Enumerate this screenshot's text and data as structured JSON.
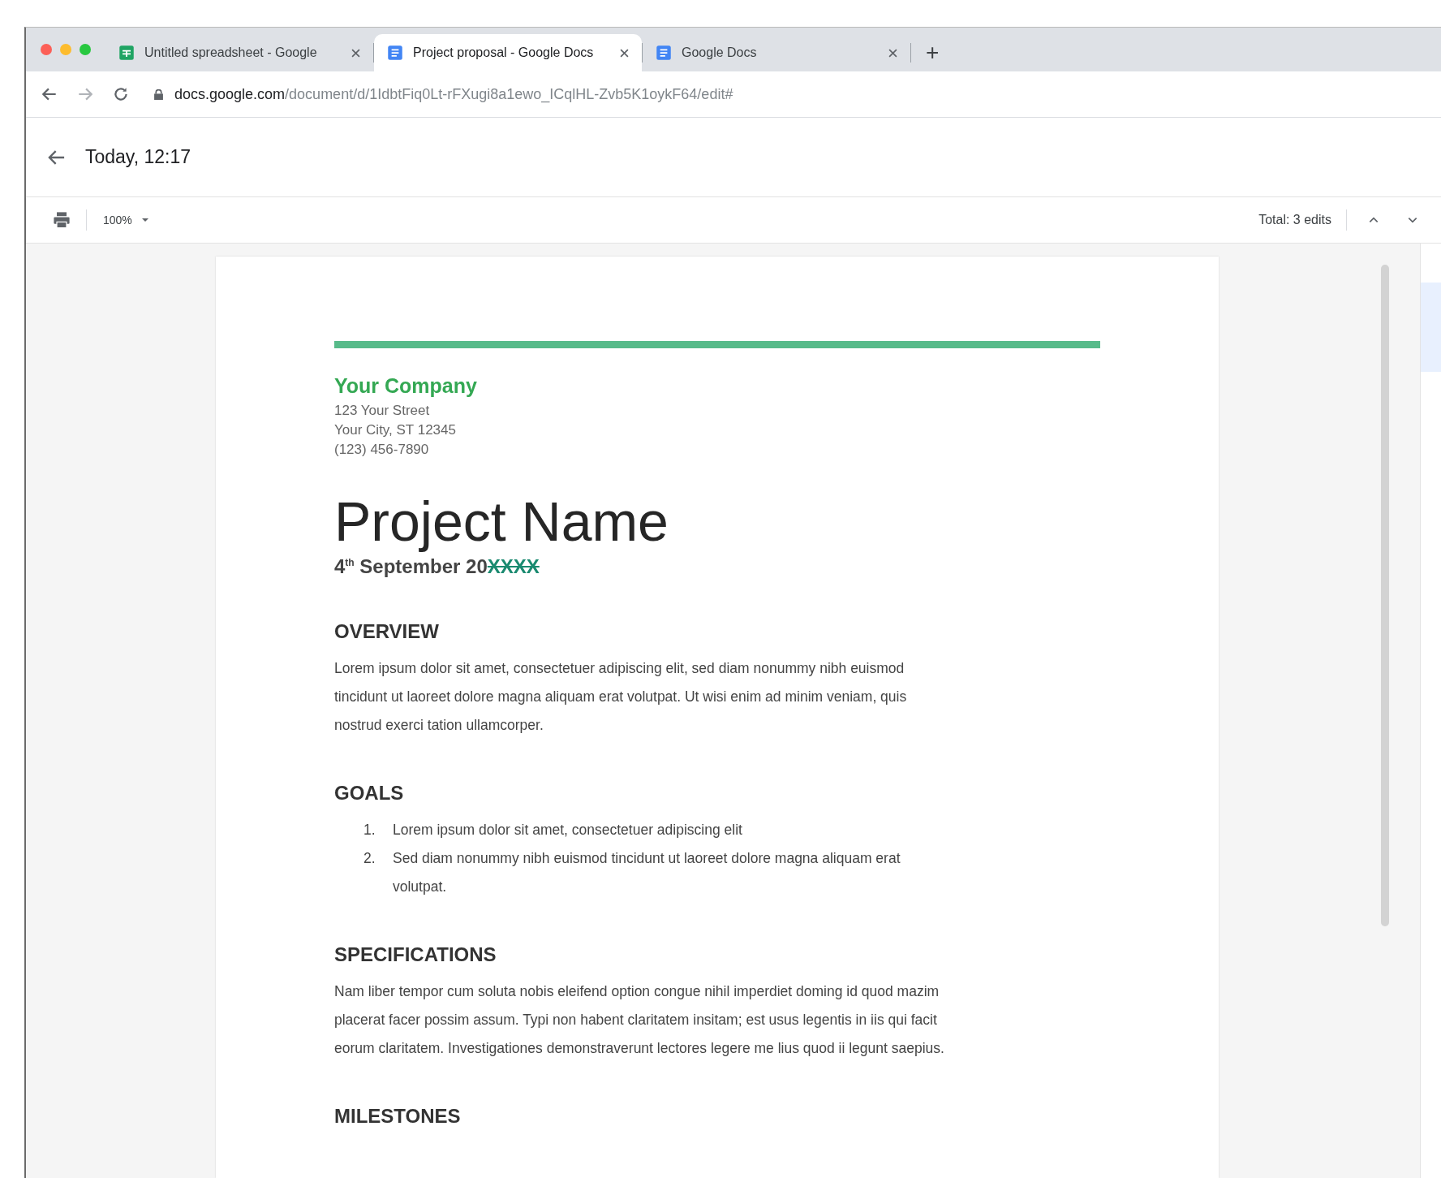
{
  "tabs": [
    {
      "title": "Untitled spreadsheet - Google",
      "kind": "sheets",
      "selected": false
    },
    {
      "title": "Project proposal - Google Docs",
      "kind": "docs",
      "selected": true
    },
    {
      "title": "Google Docs",
      "kind": "docs",
      "selected": false
    }
  ],
  "new_tab": "+",
  "address_bar": {
    "host": "docs.google.com",
    "path": "/document/d/1IdbtFiq0Lt-rFXugi8a1ewo_ICqlHL-Zvb5K1oykF64/edit#"
  },
  "header": {
    "title": "Today, 12:17"
  },
  "toolbar": {
    "zoom": "100%",
    "edits": "Total: 3 edits"
  },
  "document": {
    "company": "Your Company",
    "address_lines": [
      "123 Your Street",
      "Your City, ST 12345",
      "(123) 456-7890"
    ],
    "title": "Project Name",
    "date": {
      "text": "4$^{th}$ September 20",
      "suggestion": "XXXX"
    },
    "sections": [
      {
        "heading": "OVERVIEW",
        "kind": "paragraph",
        "text": "Lorem ipsum dolor sit amet, consectetuer adipiscing elit, sed diam nonummy nibh euismod\ntincidunt ut laoreet dolore magna aliquam erat volutpat. Ut wisi enim ad minim veniam, quis\nnostrud exerci tation ullamcorper."
      },
      {
        "heading": "GOALS",
        "kind": "list",
        "items": [
          {
            "number": "1.",
            "text": "Lorem ipsum dolor sit amet, consectetuer adipiscing elit"
          },
          {
            "number": "2.",
            "text": "Sed diam nonummy nibh euismod tincidunt ut laoreet dolore magna aliquam erat\nvolutpat."
          }
        ]
      },
      {
        "heading": "SPECIFICATIONS",
        "kind": "paragraph",
        "text": "Nam liber tempor cum soluta nobis eleifend option congue nihil imperdiet doming id quod mazim\nplacerat facer possim assum. Typi non habent claritatem insitam; est usus legentis in iis qui facit\neorum claritatem. Investigationes demonstraverunt lectores legere me lius quod ii legunt saepius."
      },
      {
        "heading": "MILESTONES",
        "kind": "heading"
      }
    ]
  }
}
